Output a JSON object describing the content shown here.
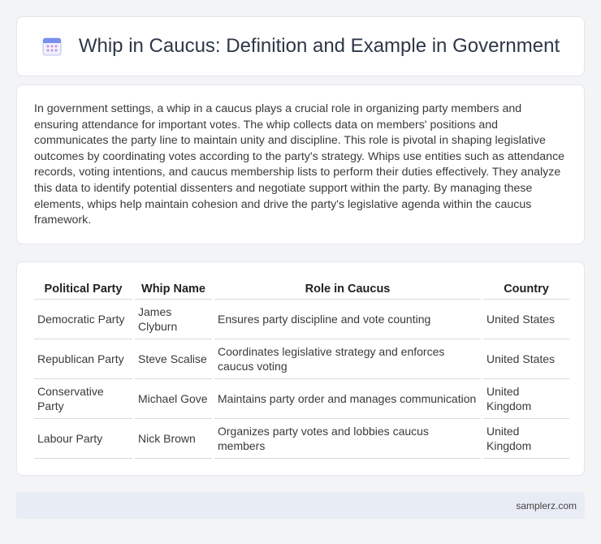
{
  "header": {
    "title": "Whip in Caucus: Definition and Example in Government",
    "icon": "calendar-icon"
  },
  "intro": {
    "text": "In government settings, a whip in a caucus plays a crucial role in organizing party members and ensuring attendance for important votes. The whip collects data on members' positions and communicates the party line to maintain unity and discipline. This role is pivotal in shaping legislative outcomes by coordinating votes according to the party's strategy. Whips use entities such as attendance records, voting intentions, and caucus membership lists to perform their duties effectively. They analyze this data to identify potential dissenters and negotiate support within the party. By managing these elements, whips help maintain cohesion and drive the party's legislative agenda within the caucus framework."
  },
  "table": {
    "headers": [
      "Political Party",
      "Whip Name",
      "Role in Caucus",
      "Country"
    ],
    "rows": [
      [
        "Democratic Party",
        "James Clyburn",
        "Ensures party discipline and vote counting",
        "United States"
      ],
      [
        "Republican Party",
        "Steve Scalise",
        "Coordinates legislative strategy and enforces caucus voting",
        "United States"
      ],
      [
        "Conservative Party",
        "Michael Gove",
        "Maintains party order and manages communication",
        "United Kingdom"
      ],
      [
        "Labour Party",
        "Nick Brown",
        "Organizes party votes and lobbies caucus members",
        "United Kingdom"
      ]
    ]
  },
  "footer": {
    "site": "samplerz.com"
  },
  "colors": {
    "background": "#f3f4f6",
    "card": "#ffffff",
    "footer": "#e8ecf4",
    "icon_accent": "#7b8ff0"
  }
}
